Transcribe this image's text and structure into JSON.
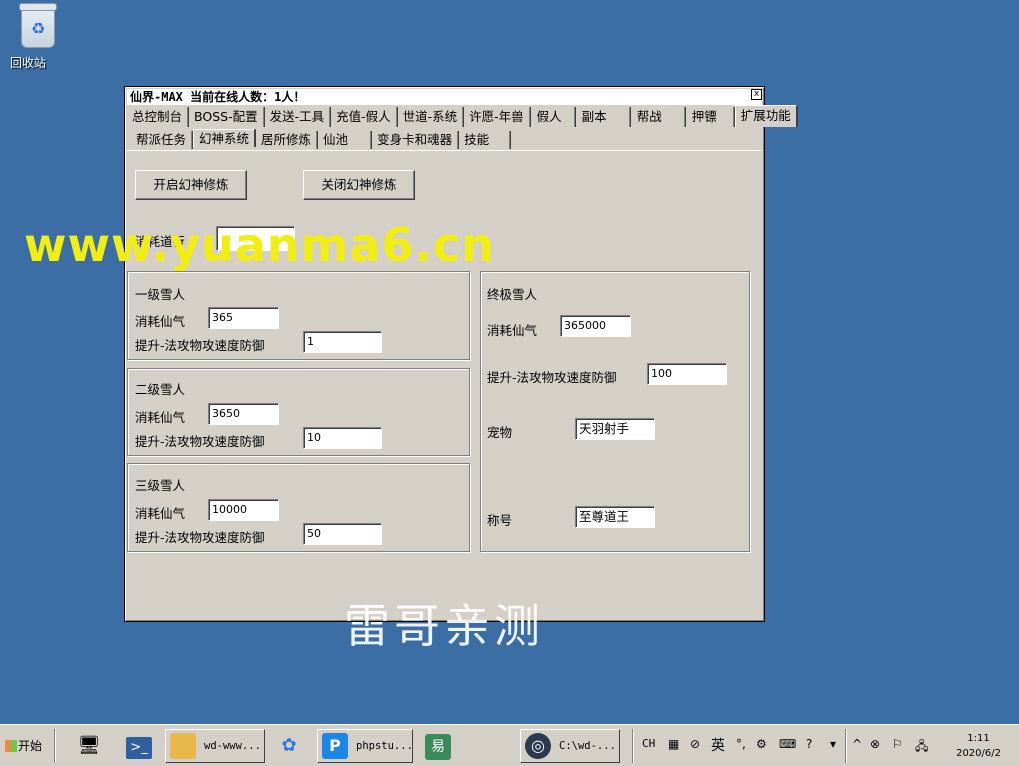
{
  "desktop": {
    "recycle_bin_label": "回收站"
  },
  "window": {
    "title": "仙界-MAX  当前在线人数：1人！",
    "close_glyph": "x",
    "tabs_row1": [
      "总控制台",
      "BOSS-配置",
      "发送-工具",
      "充值-假人",
      "世道-系统",
      "许愿-年兽",
      "假人",
      "副本",
      "帮战",
      "押镖",
      "扩展功能"
    ],
    "tabs_row2": [
      "帮派任务",
      "幻神系统",
      "居所修炼",
      "仙池",
      "变身卡和魂器",
      "技能"
    ],
    "active_tab_row1": "扩展功能",
    "active_tab_row2": "幻神系统"
  },
  "actions": {
    "start_label": "开启幻神修炼",
    "stop_label": "关闭幻神修炼"
  },
  "consume": {
    "label": "消耗道行",
    "value": ""
  },
  "level1": {
    "title": "一级雪人",
    "xianqi_label": "消耗仙气",
    "xianqi_value": "365",
    "boost_label": "提升-法攻物攻速度防御",
    "boost_value": "1"
  },
  "level2": {
    "title": "二级雪人",
    "xianqi_label": "消耗仙气",
    "xianqi_value": "3650",
    "boost_label": "提升-法攻物攻速度防御",
    "boost_value": "10"
  },
  "level3": {
    "title": "三级雪人",
    "xianqi_label": "消耗仙气",
    "xianqi_value": "10000",
    "boost_label": "提升-法攻物攻速度防御",
    "boost_value": "50"
  },
  "ultimate": {
    "title": "终极雪人",
    "xianqi_label": "消耗仙气",
    "xianqi_value": "365000",
    "boost_label": "提升-法攻物攻速度防御",
    "boost_value": "100",
    "pet_label": "宠物",
    "pet_value": "天羽射手",
    "title_label": "称号",
    "title_value": "至尊道王"
  },
  "watermarks": {
    "url": "www.yuanma6.cn",
    "caption": "雷哥亲测"
  },
  "taskbar": {
    "start_label": "开始",
    "buttons": [
      {
        "label": "wd-www...",
        "icon": "folder-icon"
      },
      {
        "label": "phpstu...",
        "icon": "phpstudy-icon"
      },
      {
        "label": "C:\\wd-...",
        "icon": "console-icon"
      }
    ],
    "tray": {
      "lang": "CH",
      "ime": "英",
      "time": "1:11",
      "date": "2020/6/2"
    }
  }
}
